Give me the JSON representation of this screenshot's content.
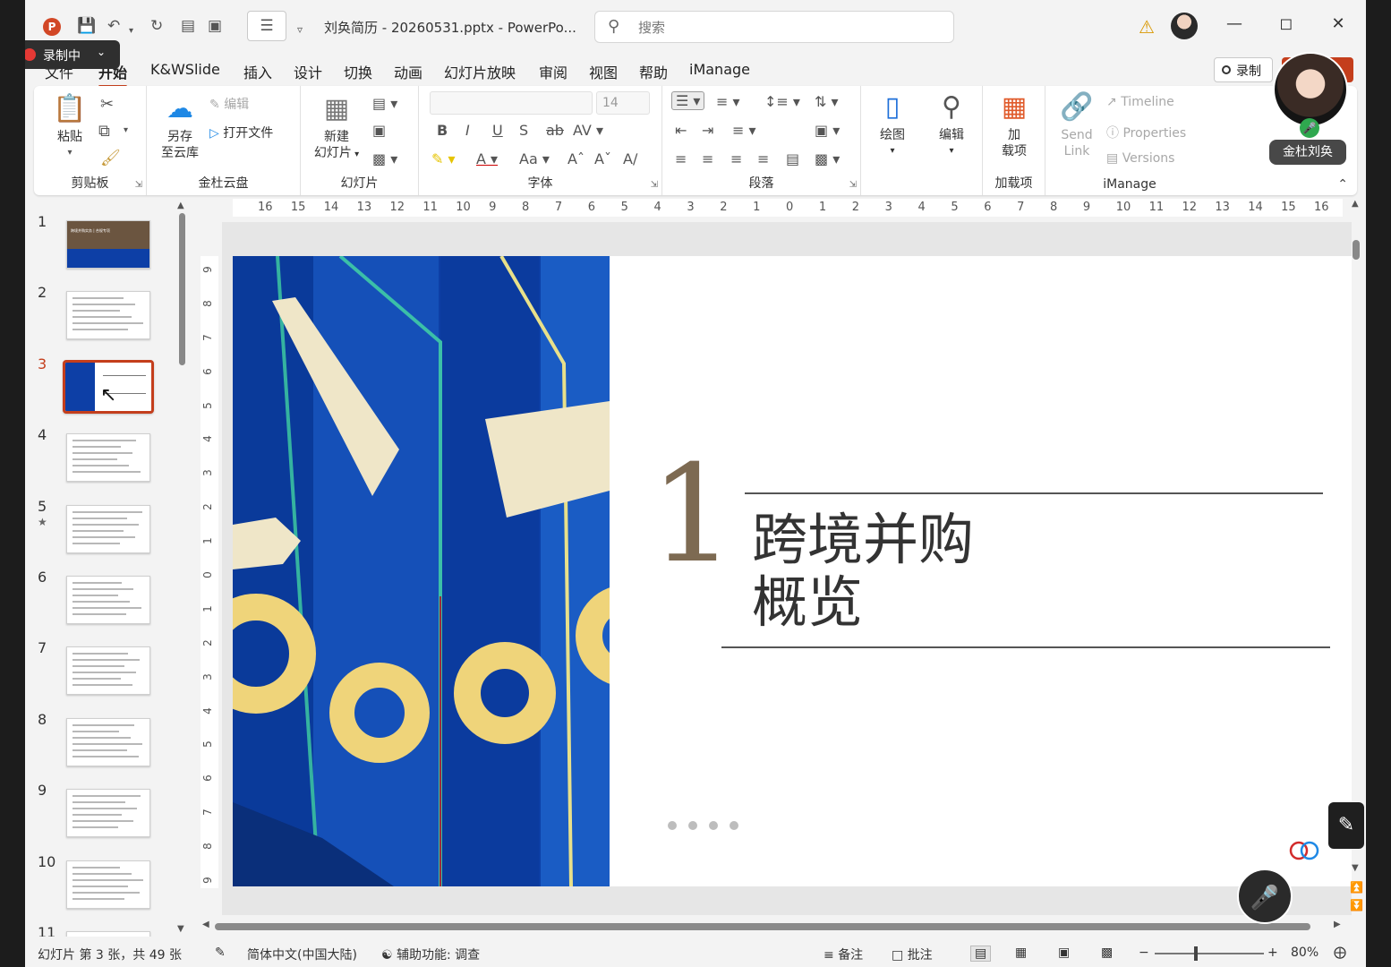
{
  "window": {
    "doc_title": "刘奂简历 - 20260531.pptx - PowerPo...",
    "search_placeholder": "搜索",
    "recording_pill": "录制中",
    "account_name": "金杜刘奂"
  },
  "menu": [
    "文件",
    "开始",
    "K&WSlide",
    "插入",
    "设计",
    "切换",
    "动画",
    "幻灯片放映",
    "审阅",
    "视图",
    "帮助",
    "iManage"
  ],
  "menu_active": "开始",
  "record_button": "录制",
  "ribbon": {
    "clipboard": {
      "paste": "粘贴",
      "label": "剪贴板"
    },
    "cloud": {
      "save_as_line1": "另存",
      "save_as_line2": "至云库",
      "edit": "编辑",
      "open_file": "打开文件",
      "label": "金杜云盘"
    },
    "slides": {
      "new_slide_line1": "新建",
      "new_slide_line2": "幻灯片",
      "label": "幻灯片"
    },
    "font": {
      "font_name": "",
      "font_size": "14",
      "label": "字体"
    },
    "paragraph": {
      "label": "段落"
    },
    "drawing": {
      "draw": "绘图"
    },
    "editing": {
      "edit": "编辑"
    },
    "addins": {
      "addin_line1": "加",
      "addin_line2": "载项",
      "label": "加载项"
    },
    "imanage": {
      "send_line1": "Send",
      "send_line2": "Link",
      "timeline": "Timeline",
      "properties": "Properties",
      "versions": "Versions",
      "label": "iManage"
    }
  },
  "thumbnails": [
    {
      "num": "1",
      "title": "跨境并购实务 | 合规专项"
    },
    {
      "num": "2"
    },
    {
      "num": "3",
      "selected": true
    },
    {
      "num": "4"
    },
    {
      "num": "5",
      "star": "★"
    },
    {
      "num": "6"
    },
    {
      "num": "7"
    },
    {
      "num": "8"
    },
    {
      "num": "9"
    },
    {
      "num": "10"
    },
    {
      "num": "11"
    }
  ],
  "ruler_h": [
    "16",
    "15",
    "14",
    "13",
    "12",
    "11",
    "10",
    "9",
    "8",
    "7",
    "6",
    "5",
    "4",
    "3",
    "2",
    "1",
    "0",
    "1",
    "2",
    "3",
    "4",
    "5",
    "6",
    "7",
    "8",
    "9",
    "10",
    "11",
    "12",
    "13",
    "14",
    "15",
    "16"
  ],
  "ruler_v": [
    "9",
    "8",
    "7",
    "6",
    "5",
    "4",
    "3",
    "2",
    "1",
    "0",
    "1",
    "2",
    "3",
    "4",
    "5",
    "6",
    "7",
    "8",
    "9"
  ],
  "slide": {
    "number": "1",
    "title_line1": "跨境并购",
    "title_line2": "概览",
    "accent_color": "#7d6a52",
    "art_blue": "#0d3fa6",
    "art_cream": "#efe6c8"
  },
  "status": {
    "slide_info": "幻灯片 第 3 张，共 49 张",
    "language": "简体中文(中国大陆)",
    "accessibility": "辅助功能: 调查",
    "notes": "备注",
    "comments": "批注",
    "zoom": "80%"
  }
}
